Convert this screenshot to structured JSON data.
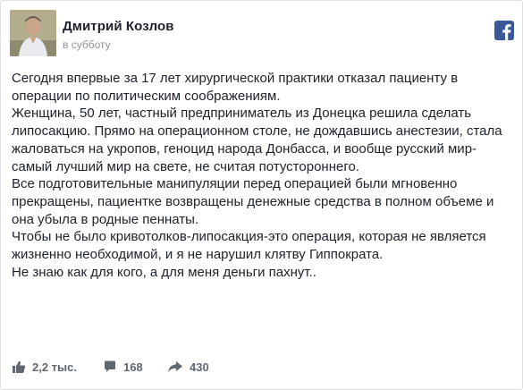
{
  "post": {
    "author": "Дмитрий Козлов",
    "time": "в субботу",
    "paragraphs": [
      "Сегодня впервые за 17 лет хирургической практики отказал пациенту в операции по политическим соображениям.",
      "Женщина, 50 лет, частный предприниматель из Донецка решила сделать липосакцию. Прямо на операционном столе, не дождавшись анестезии, стала жаловаться на укропов, геноцид народа Донбасса, и вообще русский мир-самый лучший мир на свете, не считая потустороннего.",
      "Все подготовительные манипуляции перед операцией были мгновенно прекращены, пациентке возвращены денежные средства в полном объеме и она убыла в родные пеннаты.",
      "Чтобы не было кривотолков-липосакция-это операция, которая не является жизненно необходимой, и я не нарушил клятву Гиппократа.",
      "Не знаю как для кого, а для меня деньги пахнут.."
    ]
  },
  "stats": {
    "likes": "2,2 тыс.",
    "comments": "168",
    "shares": "430"
  },
  "icons": {
    "brand": "facebook-icon",
    "like": "thumbs-up-icon",
    "comment": "comment-icon",
    "share": "share-arrow-icon"
  },
  "colors": {
    "brand": "#3b5998",
    "text": "#1d2129",
    "muted": "#90949c"
  }
}
